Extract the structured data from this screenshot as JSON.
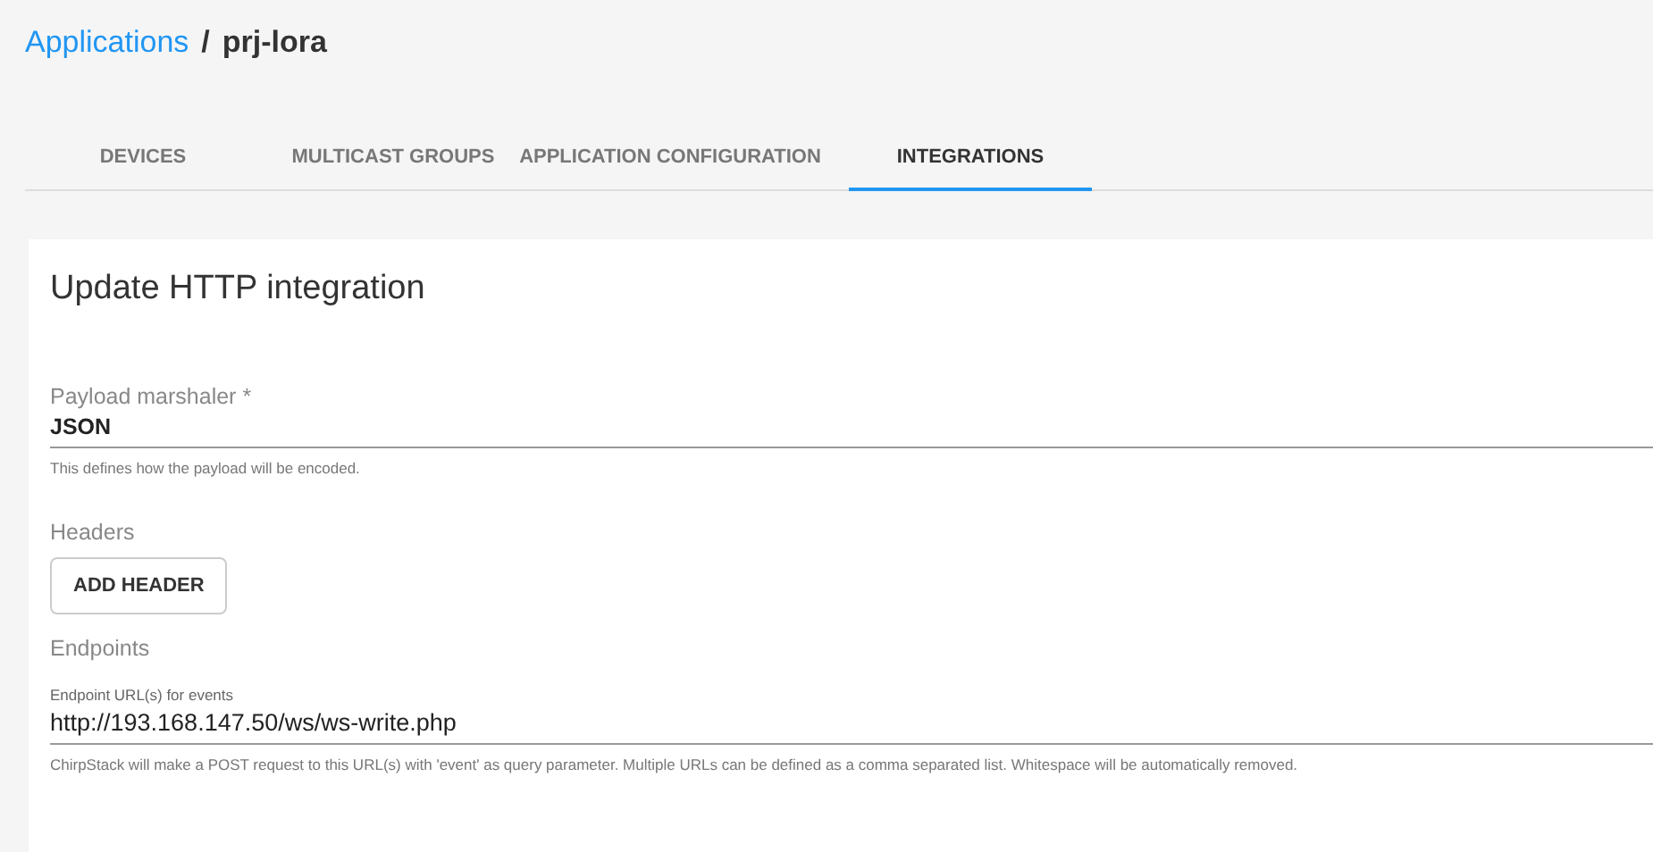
{
  "breadcrumb": {
    "parent": "Applications",
    "separator": "/",
    "current": "prj-lora"
  },
  "tabs": [
    {
      "label": "DEVICES",
      "selected": false
    },
    {
      "label": "MULTICAST GROUPS",
      "selected": false
    },
    {
      "label": "APPLICATION CONFIGURATION",
      "selected": false
    },
    {
      "label": "INTEGRATIONS",
      "selected": true
    }
  ],
  "form": {
    "title": "Update HTTP integration",
    "payload_marshaler": {
      "label": "Payload marshaler *",
      "value": "JSON",
      "helper": "This defines how the payload will be encoded."
    },
    "headers": {
      "label": "Headers",
      "button": "ADD HEADER"
    },
    "endpoints": {
      "label": "Endpoints",
      "field_label": "Endpoint URL(s) for events",
      "value": "http://193.168.147.50/ws/ws-write.php",
      "helper": "ChirpStack will make a POST request to this URL(s) with 'event' as query parameter. Multiple URLs can be defined as a comma separated list. Whitespace will be automatically removed."
    }
  }
}
